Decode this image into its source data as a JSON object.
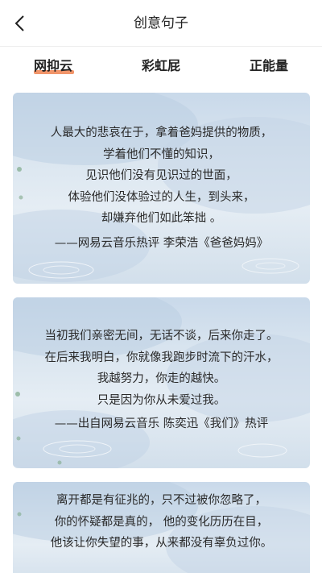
{
  "header": {
    "title": "创意句子"
  },
  "tabs": [
    {
      "label": "网抑云"
    },
    {
      "label": "彩虹屁"
    },
    {
      "label": "正能量"
    }
  ],
  "cards": [
    {
      "lines": [
        "人最大的悲哀在于，拿着爸妈提供的物质，",
        "学着他们不懂的知识，",
        "见识他们没有见识过的世面，",
        "体验他们没体验过的人生，到头来，",
        "却嫌弃他们如此笨拙 。"
      ],
      "source": "——网易云音乐热评 李荣浩《爸爸妈妈》"
    },
    {
      "lines": [
        "当初我们亲密无间，无话不谈，后来你走了。",
        "在后来我明白，你就像我跑步时流下的汗水，",
        "我越努力，你走的越快。",
        "只是因为你从未爱过我。"
      ],
      "source": "——出自网易云音乐 陈奕迅《我们》热评"
    },
    {
      "lines": [
        "离开都是有征兆的，只不过被你忽略了，",
        "你的怀疑都是真的， 他的变化历历在目，",
        "他该让你失望的事，从来都没有辜负过你。"
      ]
    }
  ],
  "colors": {
    "accent": "#f08a5a",
    "card_tint": "#c9d9ea"
  }
}
